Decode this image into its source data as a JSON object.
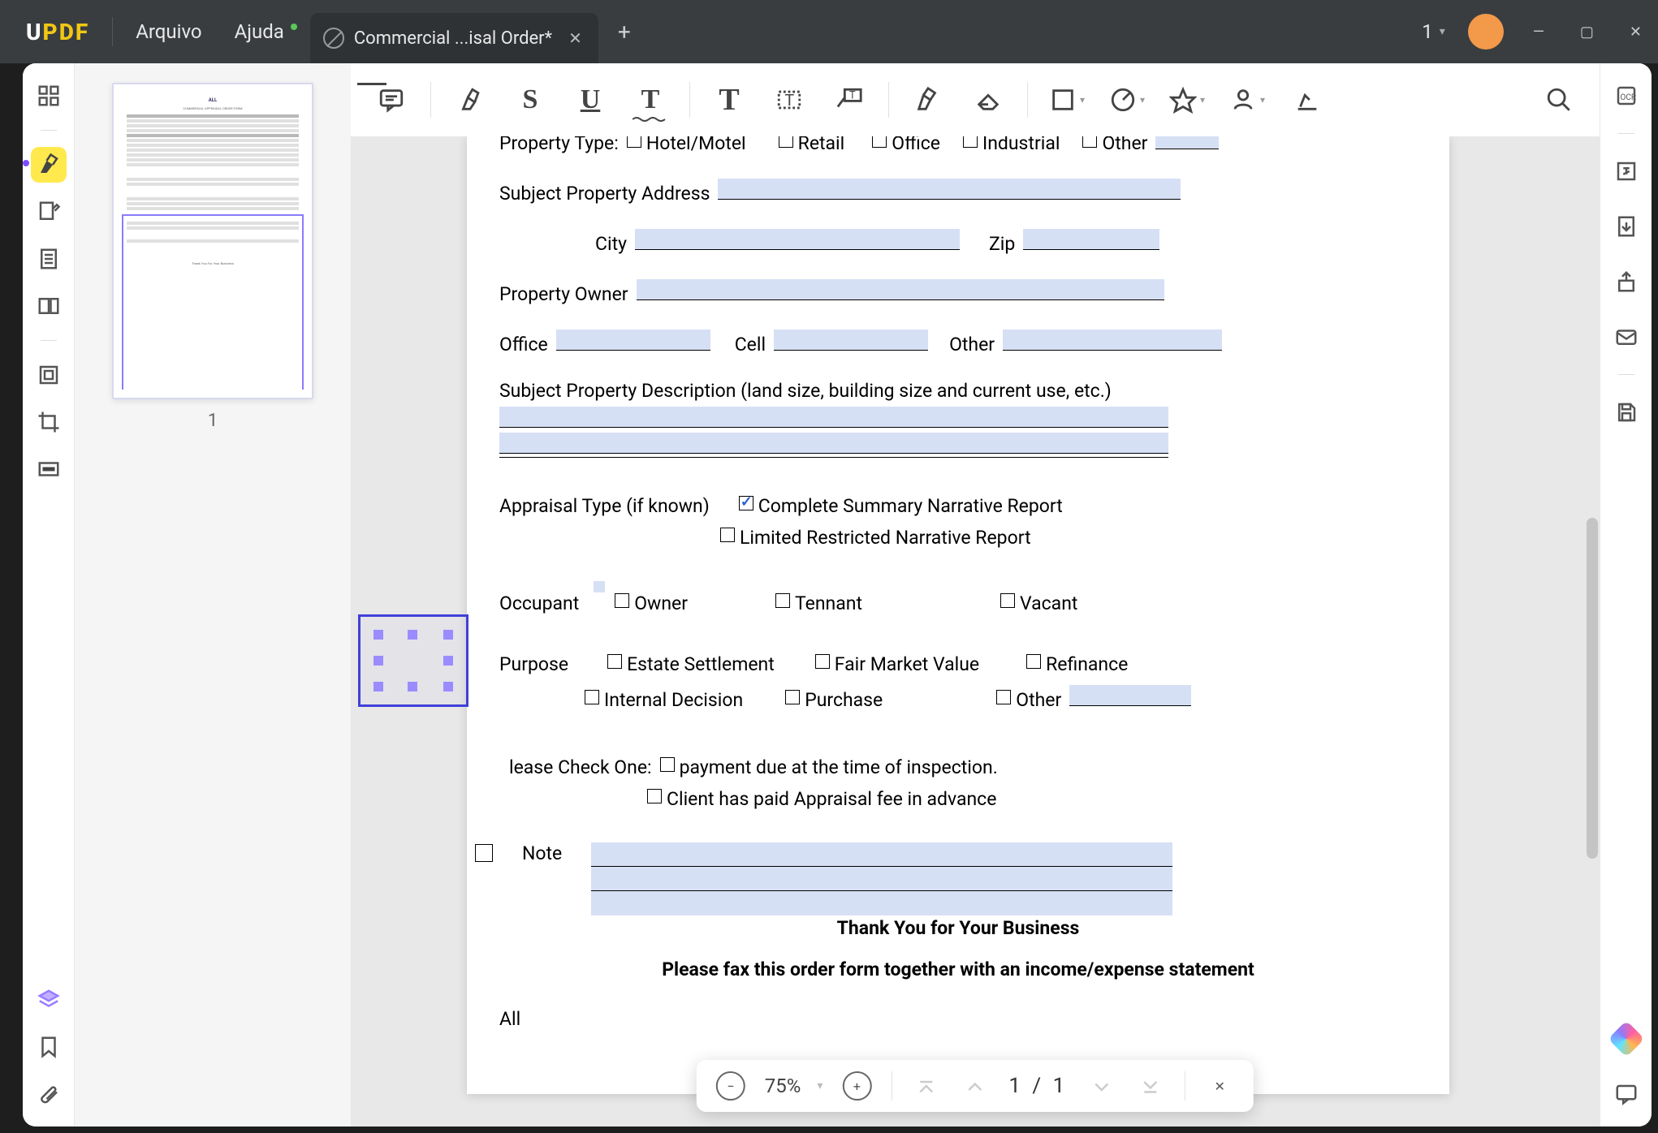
{
  "titlebar": {
    "logo": "UPDF",
    "menu": {
      "arquivo": "Arquivo",
      "ajuda": "Ajuda"
    },
    "tab_title": "Commercial ...isal Order*",
    "page_indicator": "1"
  },
  "thumbnail": {
    "page_num": "1"
  },
  "form": {
    "property_type": {
      "label": "Property Type:",
      "opts": [
        "Hotel/Motel",
        "Retail",
        "Office",
        "Industrial",
        "Other"
      ]
    },
    "subject_address": {
      "label": "Subject Property Address"
    },
    "city": {
      "label": "City"
    },
    "zip": {
      "label": "Zip"
    },
    "property_owner": {
      "label": "Property Owner"
    },
    "office": {
      "label": "Office"
    },
    "cell": {
      "label": "Cell"
    },
    "other_phone": {
      "label": "Other"
    },
    "description": {
      "label": "Subject Property Description (land size, building size and current use, etc.)"
    },
    "appraisal_type": {
      "label": "Appraisal Type (if known)",
      "opt1": "Complete Summary Narrative Report",
      "opt2": "Limited Restricted Narrative Report"
    },
    "occupant": {
      "label": "Occupant",
      "opts": [
        "Owner",
        "Tennant",
        "Vacant"
      ]
    },
    "purpose": {
      "label": "Purpose",
      "opts1": [
        "Estate Settlement",
        "Fair Market Value",
        "Refinance"
      ],
      "opts2": [
        "Internal Decision",
        "Purchase",
        "Other"
      ]
    },
    "check_one": {
      "label": "lease Check One:",
      "opt1": "payment due at the time of inspection.",
      "opt2": "Client has paid Appraisal fee in advance"
    },
    "note": {
      "label": "Note"
    },
    "thanks": "Thank You for Your Business",
    "fax": "Please fax this order form together with an income/expense statement",
    "footer_left": "All"
  },
  "navbar": {
    "zoom": "75%",
    "page": "1 / 1"
  }
}
